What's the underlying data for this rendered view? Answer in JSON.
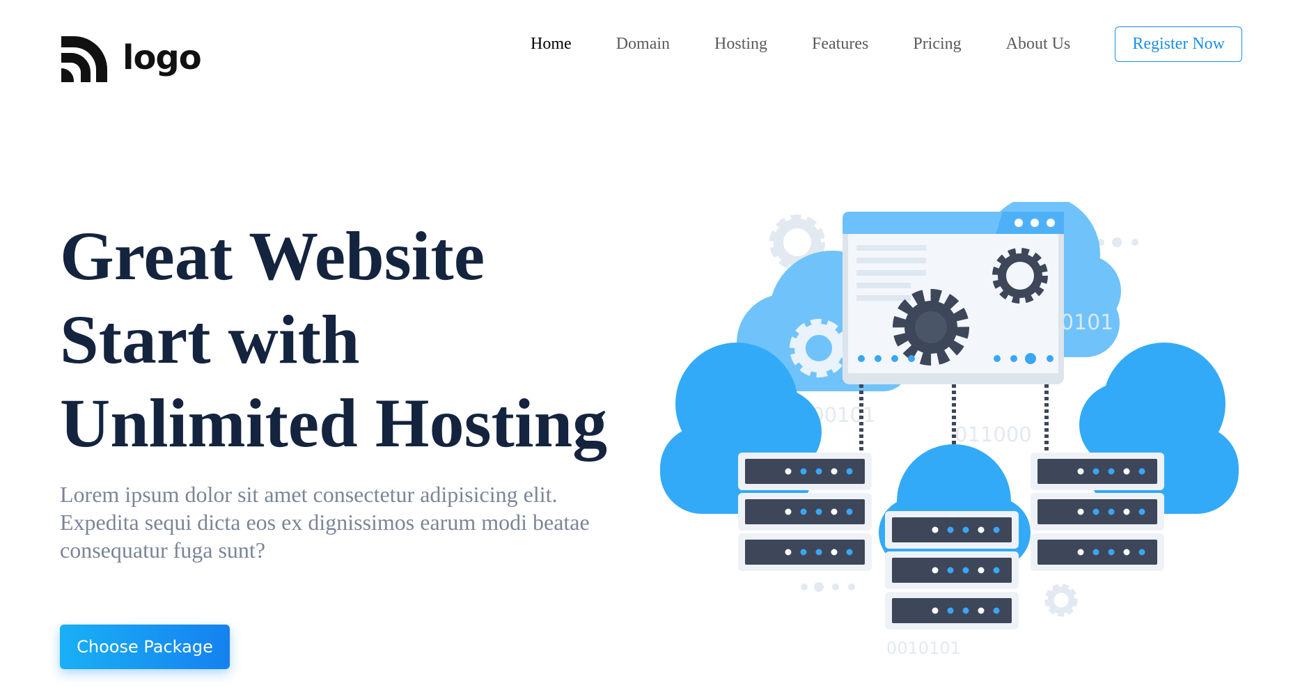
{
  "header": {
    "logo_text": "logo",
    "nav": [
      "Home",
      "Domain",
      "Hosting",
      "Features",
      "Pricing",
      "About Us"
    ],
    "register_label": "Register Now"
  },
  "hero": {
    "title_lines": [
      "Great Website",
      "Start with",
      "Unlimited Hosting"
    ],
    "description": "Lorem ipsum dolor sit amet consectetur adipisicing elit. Expedita sequi dicta eos ex dignissimos earum modi beatae consequatur fuga sunt?",
    "cta_label": "Choose Package"
  },
  "illustration": {
    "binary_1": "0101",
    "binary_2": "001011000101",
    "binary_3": "011000",
    "binary_4": "0010101"
  },
  "colors": {
    "title": "#14243f",
    "accent": "#1a8fe6",
    "cloud_light": "#6fc3fa",
    "cloud": "#33aaf7",
    "server_dark": "#3d4759",
    "gear_pale": "#e3e9f1"
  }
}
